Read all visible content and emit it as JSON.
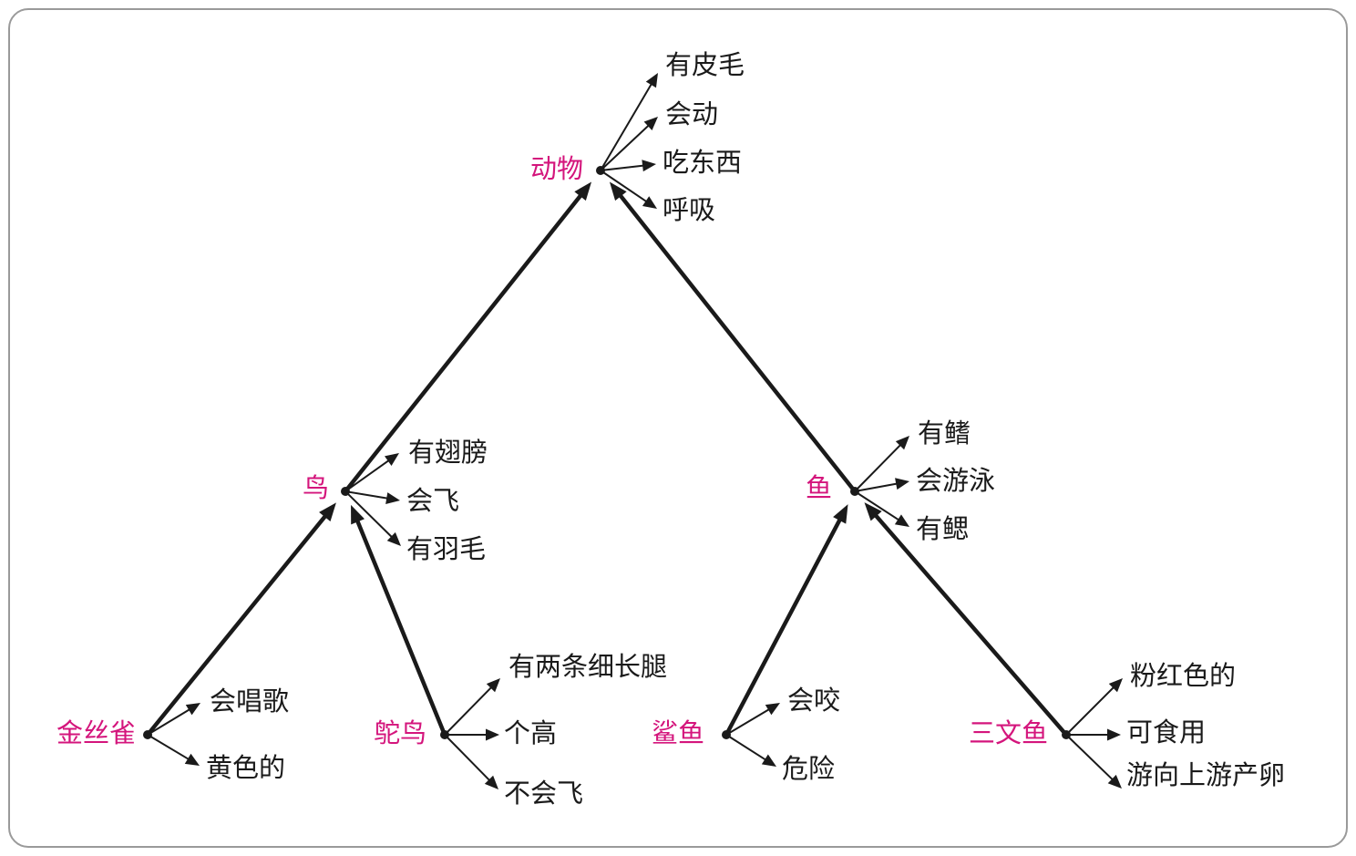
{
  "colors": {
    "concept": "#d4157c",
    "attribute": "#1a1a1a",
    "line": "#1a1a1a",
    "frame": "#9a9a9a"
  },
  "nodes": {
    "animal": "动物",
    "bird": "鸟",
    "fish": "鱼",
    "canary": "金丝雀",
    "ostrich": "鸵鸟",
    "shark": "鲨鱼",
    "salmon": "三文鱼"
  },
  "attributes": {
    "animal": [
      "有皮毛",
      "会动",
      "吃东西",
      "呼吸"
    ],
    "bird": [
      "有翅膀",
      "会飞",
      "有羽毛"
    ],
    "fish": [
      "有鳍",
      "会游泳",
      "有鳃"
    ],
    "canary": [
      "会唱歌",
      "黄色的"
    ],
    "ostrich": [
      "有两条细长腿",
      "个高",
      "不会飞"
    ],
    "shark": [
      "会咬",
      "危险"
    ],
    "salmon": [
      "粉红色的",
      "可食用",
      "游向上游产卵"
    ]
  },
  "hierarchy": [
    {
      "from": "bird",
      "to": "animal"
    },
    {
      "from": "fish",
      "to": "animal"
    },
    {
      "from": "canary",
      "to": "bird"
    },
    {
      "from": "ostrich",
      "to": "bird"
    },
    {
      "from": "shark",
      "to": "fish"
    },
    {
      "from": "salmon",
      "to": "fish"
    }
  ]
}
